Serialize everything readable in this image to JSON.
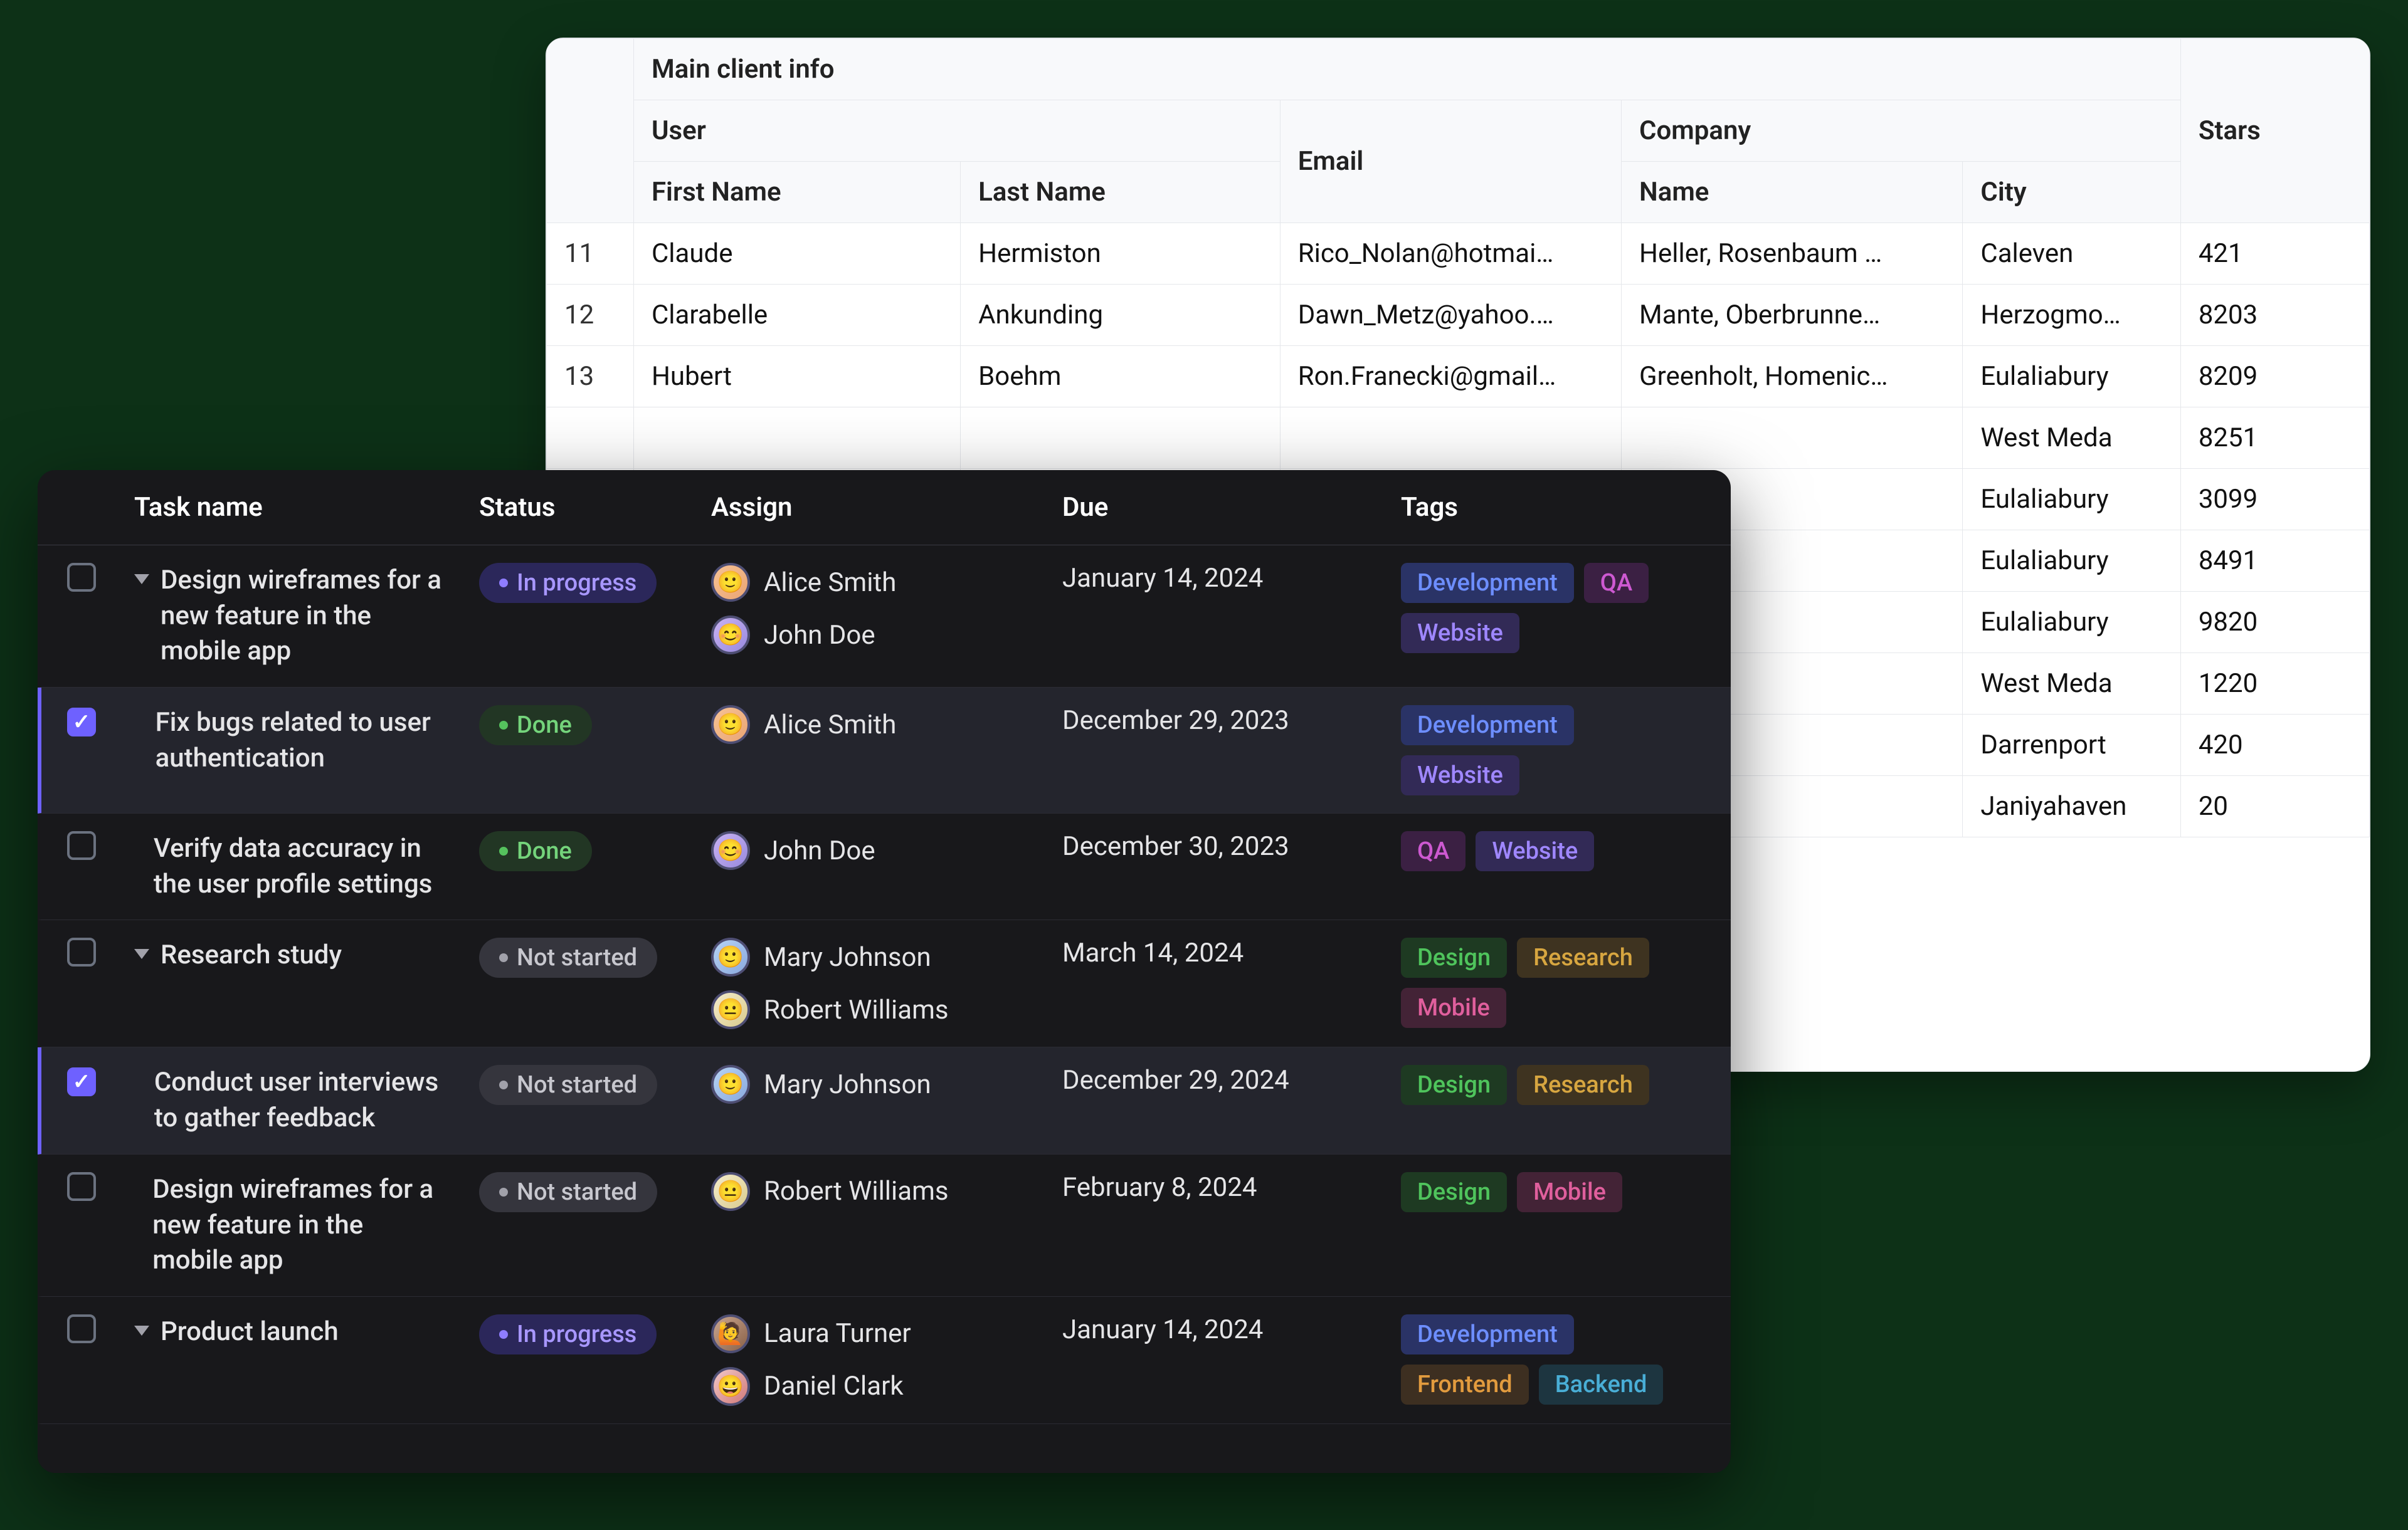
{
  "light": {
    "header_group": "Main client info",
    "header_user": "User",
    "header_company": "Company",
    "header_email": "Email",
    "header_first": "First Name",
    "header_last": "Last Name",
    "header_cname": "Name",
    "header_city": "City",
    "header_stars": "Stars",
    "rows": [
      {
        "n": "11",
        "first": "Claude",
        "last": "Hermiston",
        "email": "Rico_Nolan@hotmai…",
        "company": "Heller, Rosenbaum …",
        "city": "Caleven",
        "stars": "421"
      },
      {
        "n": "12",
        "first": "Clarabelle",
        "last": "Ankunding",
        "email": "Dawn_Metz@yahoo.…",
        "company": "Mante, Oberbrunne…",
        "city": "Herzogmo…",
        "stars": "8203"
      },
      {
        "n": "13",
        "first": "Hubert",
        "last": "Boehm",
        "email": "Ron.Franecki@gmail…",
        "company": "Greenholt, Homenic…",
        "city": "Eulaliabury",
        "stars": "8209"
      },
      {
        "n": "",
        "first": "",
        "last": "",
        "email": "",
        "company": "",
        "city": "West Meda",
        "stars": "8251"
      },
      {
        "n": "",
        "first": "",
        "last": "",
        "email": "",
        "company": ".",
        "city": "Eulaliabury",
        "stars": "3099"
      },
      {
        "n": "",
        "first": "",
        "last": "",
        "email": "",
        "company": "",
        "city": "Eulaliabury",
        "stars": "8491"
      },
      {
        "n": "",
        "first": "",
        "last": "",
        "email": "",
        "company": "",
        "city": "Eulaliabury",
        "stars": "9820"
      },
      {
        "n": "",
        "first": "",
        "last": "",
        "email": "",
        "company": "",
        "city": "West Meda",
        "stars": "1220"
      },
      {
        "n": "",
        "first": "",
        "last": "",
        "email": "",
        "company": "",
        "city": "Darrenport",
        "stars": "420"
      },
      {
        "n": "",
        "first": "",
        "last": "",
        "email": "",
        "company": "",
        "city": "Janiyahaven",
        "stars": "20"
      }
    ]
  },
  "dark": {
    "head_task": "Task name",
    "head_status": "Status",
    "head_assign": "Assign",
    "head_due": "Due",
    "head_tags": "Tags",
    "status_inprogress": "In progress",
    "status_done": "Done",
    "status_notstarted": "Not started",
    "tags": {
      "development": "Development",
      "qa": "QA",
      "website": "Website",
      "design": "Design",
      "research": "Research",
      "mobile": "Mobile",
      "frontend": "Frontend",
      "backend": "Backend"
    },
    "people": {
      "alice": "Alice Smith",
      "john": "John Doe",
      "mary": "Mary Johnson",
      "robert": "Robert Williams",
      "laura": "Laura Turner",
      "daniel": "Daniel Clark"
    },
    "rows": [
      {
        "task": "Design wireframes for a new feature in the mobile app",
        "due": "January 14, 2024"
      },
      {
        "task": "Fix bugs related to user authentication",
        "due": "December 29, 2023"
      },
      {
        "task": "Verify data accuracy in the user profile settings",
        "due": "December 30, 2023"
      },
      {
        "task": "Research study",
        "due": "March 14, 2024"
      },
      {
        "task": "Conduct user interviews to gather feedback",
        "due": "December 29, 2024"
      },
      {
        "task": "Design wireframes for a new feature in the mobile app",
        "due": "February 8, 2024"
      },
      {
        "task": "Product launch",
        "due": "January 14, 2024"
      }
    ]
  }
}
